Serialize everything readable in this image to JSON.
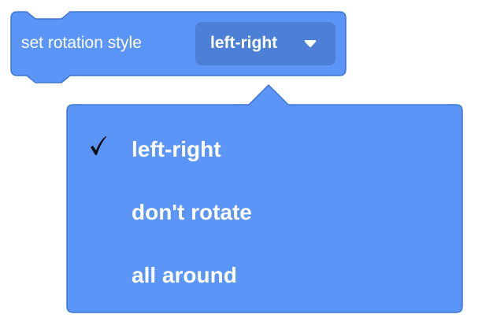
{
  "block": {
    "label": "set rotation style",
    "selected_value": "left-right",
    "caret_icon": "caret-down-icon",
    "color": "#5b95f7",
    "field_color": "#4c7fd6",
    "border_color": "#3f77d2"
  },
  "menu": {
    "items": [
      {
        "label": "left-right",
        "checked": true
      },
      {
        "label": "don't rotate",
        "checked": false
      },
      {
        "label": "all around",
        "checked": false
      }
    ],
    "check_icon": "checkmark-icon",
    "background": "#5b95f7",
    "border_color": "#3f77d2"
  }
}
